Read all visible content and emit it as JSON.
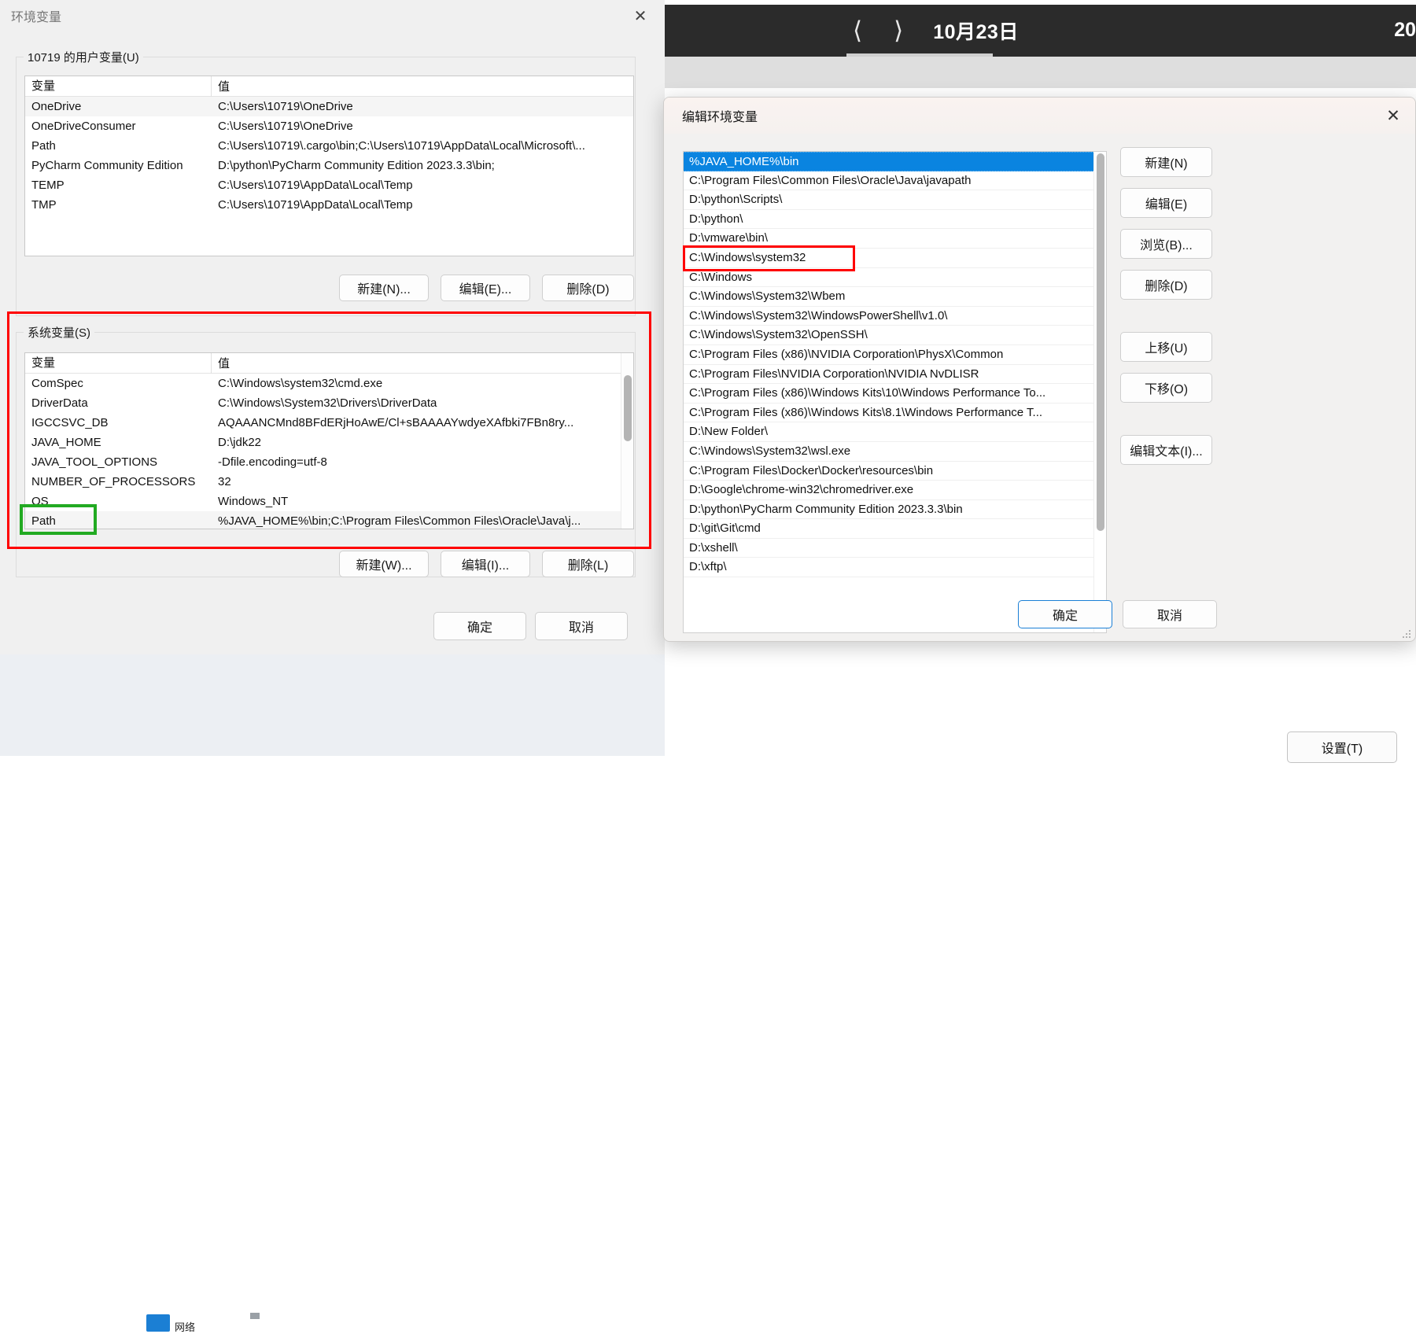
{
  "backdrop": {
    "date_nav": {
      "prev_icon": "chevron-left-icon",
      "next_icon": "chevron-right-icon",
      "date_label": "10月23日",
      "date_right_partial": "20"
    },
    "taskbar": {
      "item_label": "网络"
    },
    "settings_button": "设置(T)"
  },
  "env_dialog": {
    "title": "环境变量",
    "close_icon": "✕",
    "user_section": {
      "legend": "10719 的用户变量(U)",
      "columns": [
        "变量",
        "值"
      ],
      "rows": [
        {
          "name": "OneDrive",
          "value": "C:\\Users\\10719\\OneDrive"
        },
        {
          "name": "OneDriveConsumer",
          "value": "C:\\Users\\10719\\OneDrive"
        },
        {
          "name": "Path",
          "value": "C:\\Users\\10719\\.cargo\\bin;C:\\Users\\10719\\AppData\\Local\\Microsoft\\..."
        },
        {
          "name": "PyCharm Community Edition",
          "value": "D:\\python\\PyCharm Community Edition 2023.3.3\\bin;"
        },
        {
          "name": "TEMP",
          "value": "C:\\Users\\10719\\AppData\\Local\\Temp"
        },
        {
          "name": "TMP",
          "value": "C:\\Users\\10719\\AppData\\Local\\Temp"
        }
      ],
      "buttons": {
        "new": "新建(N)...",
        "edit": "编辑(E)...",
        "delete": "删除(D)"
      }
    },
    "system_section": {
      "legend": "系统变量(S)",
      "columns": [
        "变量",
        "值"
      ],
      "rows": [
        {
          "name": "ComSpec",
          "value": "C:\\Windows\\system32\\cmd.exe"
        },
        {
          "name": "DriverData",
          "value": "C:\\Windows\\System32\\Drivers\\DriverData"
        },
        {
          "name": "IGCCSVC_DB",
          "value": "AQAAANCMnd8BFdERjHoAwE/Cl+sBAAAAYwdyeXAfbki7FBn8ry..."
        },
        {
          "name": "JAVA_HOME",
          "value": "D:\\jdk22"
        },
        {
          "name": "JAVA_TOOL_OPTIONS",
          "value": "-Dfile.encoding=utf-8"
        },
        {
          "name": "NUMBER_OF_PROCESSORS",
          "value": "32"
        },
        {
          "name": "OS",
          "value": "Windows_NT"
        },
        {
          "name": "Path",
          "value": "%JAVA_HOME%\\bin;C:\\Program Files\\Common Files\\Oracle\\Java\\j..."
        }
      ],
      "selected_row": "Path",
      "buttons": {
        "new": "新建(W)...",
        "edit": "编辑(I)...",
        "delete": "删除(L)"
      }
    },
    "footer_buttons": {
      "ok": "确定",
      "cancel": "取消"
    }
  },
  "edit_dialog": {
    "title": "编辑环境变量",
    "close_icon": "✕",
    "path_entries": [
      "%JAVA_HOME%\\bin",
      "C:\\Program Files\\Common Files\\Oracle\\Java\\javapath",
      "D:\\python\\Scripts\\",
      "D:\\python\\",
      "D:\\vmware\\bin\\",
      "C:\\Windows\\system32",
      "C:\\Windows",
      "C:\\Windows\\System32\\Wbem",
      "C:\\Windows\\System32\\WindowsPowerShell\\v1.0\\",
      "C:\\Windows\\System32\\OpenSSH\\",
      "C:\\Program Files (x86)\\NVIDIA Corporation\\PhysX\\Common",
      "C:\\Program Files\\NVIDIA Corporation\\NVIDIA NvDLISR",
      "C:\\Program Files (x86)\\Windows Kits\\10\\Windows Performance To...",
      "C:\\Program Files (x86)\\Windows Kits\\8.1\\Windows Performance T...",
      "D:\\New Folder\\",
      "C:\\Windows\\System32\\wsl.exe",
      "C:\\Program Files\\Docker\\Docker\\resources\\bin",
      "D:\\Google\\chrome-win32\\chromedriver.exe",
      "D:\\python\\PyCharm Community Edition 2023.3.3\\bin",
      "D:\\git\\Git\\cmd",
      "D:\\xshell\\",
      "D:\\xftp\\"
    ],
    "selected_index": 0,
    "highlighted_index": 5,
    "side_buttons": [
      "新建(N)",
      "编辑(E)",
      "浏览(B)...",
      "删除(D)",
      "上移(U)",
      "下移(O)",
      "编辑文本(I)..."
    ],
    "footer_buttons": {
      "ok": "确定",
      "cancel": "取消"
    }
  },
  "annotations": {
    "colors": {
      "red": "#ff0000",
      "green": "#22aa22",
      "selection_blue": "#0a84e0"
    }
  }
}
